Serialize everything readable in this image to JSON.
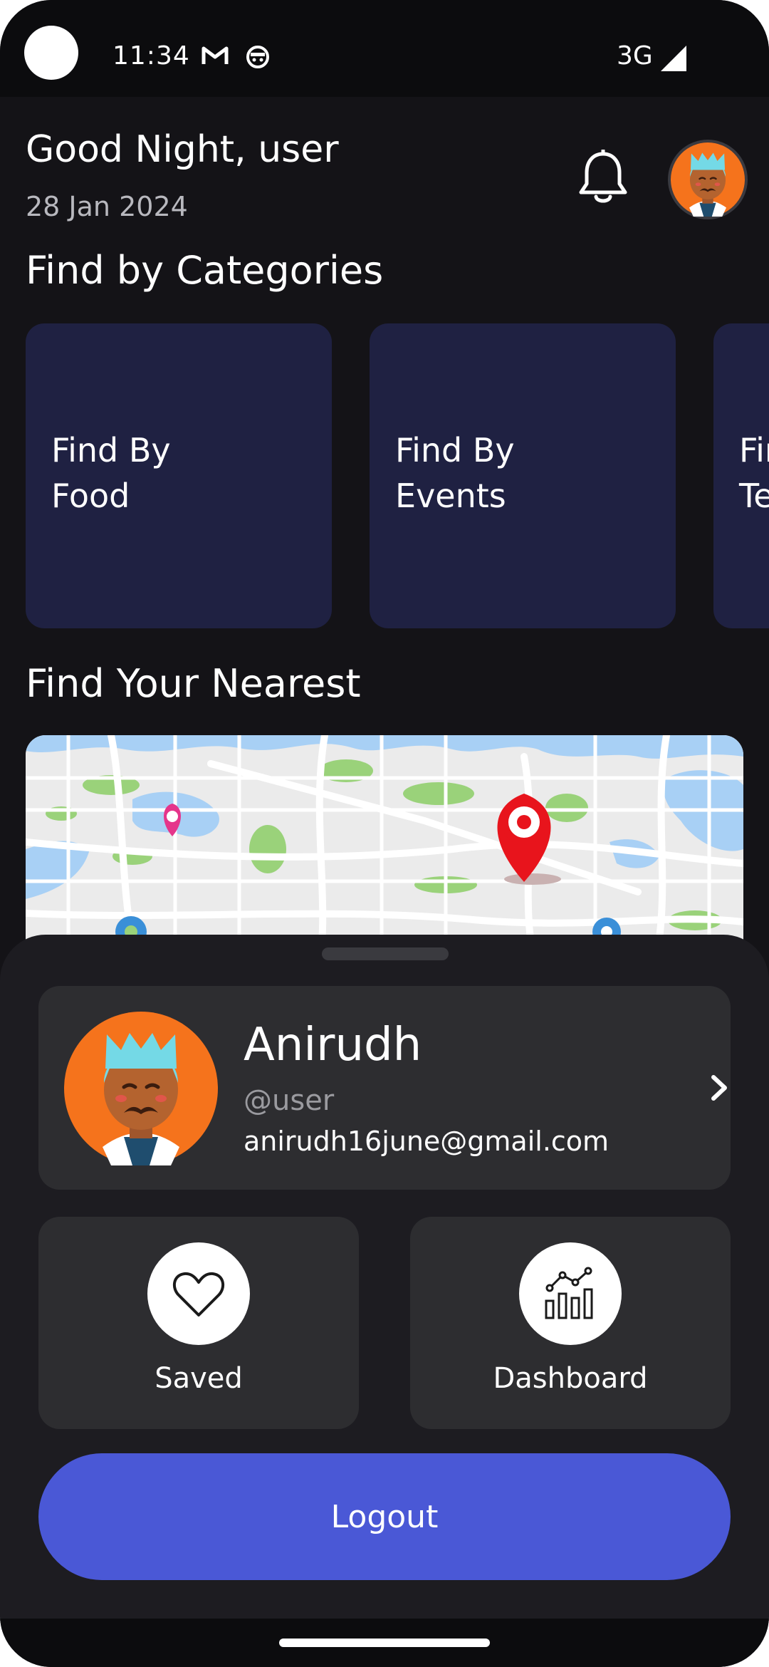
{
  "status_bar": {
    "time": "11:34",
    "network": "3G",
    "icons": [
      "gmail-icon",
      "android-debug-icon",
      "signal-icon"
    ]
  },
  "header": {
    "greeting": "Good Night, user",
    "date": "28 Jan 2024",
    "icons": [
      "bell-icon",
      "avatar"
    ]
  },
  "categories": {
    "title": "Find by Categories",
    "items": [
      {
        "label": "Find By\nFood"
      },
      {
        "label": "Find By\nEvents"
      },
      {
        "label": "Find By\nTe"
      }
    ]
  },
  "nearest": {
    "title": "Find Your Nearest"
  },
  "profile": {
    "name": "Anirudh",
    "handle": "@user",
    "email": "anirudh16june@gmail.com"
  },
  "actions": {
    "saved_label": "Saved",
    "dashboard_label": "Dashboard",
    "logout_label": "Logout"
  },
  "colors": {
    "background": "#141317",
    "card": "#1f2142",
    "sheet": "#1d1c21",
    "tile": "#2d2d30",
    "accent": "#4a58d6",
    "avatar_bg": "#f5731c"
  }
}
